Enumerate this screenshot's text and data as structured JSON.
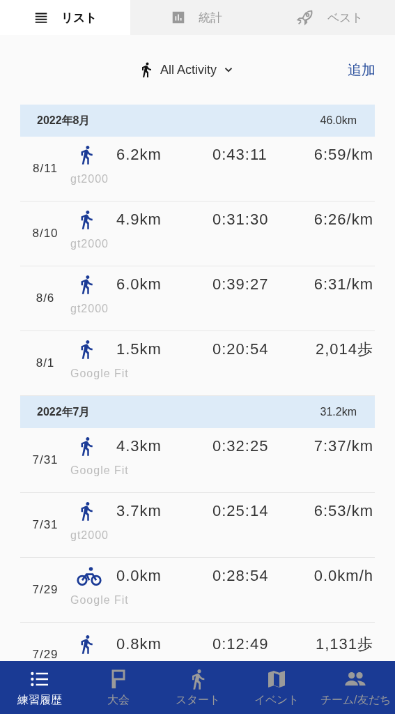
{
  "tabs": [
    {
      "label": "リスト",
      "selected": true
    },
    {
      "label": "統計",
      "selected": false
    },
    {
      "label": "ベスト",
      "selected": false
    }
  ],
  "filter": {
    "label": "All Activity"
  },
  "add_button": "追加",
  "entries": [
    {
      "kind": "month",
      "label": "2022年8月",
      "total": "46.0km"
    },
    {
      "kind": "run",
      "date": "8/11",
      "source": "gt2000",
      "distance": "6.2km",
      "time": "0:43:11",
      "pace": "6:59/km"
    },
    {
      "kind": "run",
      "date": "8/10",
      "source": "gt2000",
      "distance": "4.9km",
      "time": "0:31:30",
      "pace": "6:26/km"
    },
    {
      "kind": "run",
      "date": "8/6",
      "source": "gt2000",
      "distance": "6.0km",
      "time": "0:39:27",
      "pace": "6:31/km"
    },
    {
      "kind": "walk",
      "date": "8/1",
      "source": "Google Fit",
      "distance": "1.5km",
      "time": "0:20:54",
      "pace": "2,014歩"
    },
    {
      "kind": "month",
      "label": "2022年7月",
      "total": "31.2km"
    },
    {
      "kind": "run",
      "date": "7/31",
      "source": "Google Fit",
      "distance": "4.3km",
      "time": "0:32:25",
      "pace": "7:37/km"
    },
    {
      "kind": "run",
      "date": "7/31",
      "source": "gt2000",
      "distance": "3.7km",
      "time": "0:25:14",
      "pace": "6:53/km"
    },
    {
      "kind": "bike",
      "date": "7/29",
      "source": "Google Fit",
      "distance": "0.0km",
      "time": "0:28:54",
      "pace": "0.0km/h"
    },
    {
      "kind": "walk",
      "date": "7/29",
      "distance": "0.8km",
      "time": "0:12:49",
      "pace": "1,131歩"
    }
  ],
  "bottom_nav": [
    {
      "label": "練習履歴",
      "selected": true
    },
    {
      "label": "大会",
      "selected": false
    },
    {
      "label": "スタート",
      "selected": false
    },
    {
      "label": "イベント",
      "selected": false
    },
    {
      "label": "チーム/友だち",
      "selected": false
    }
  ]
}
